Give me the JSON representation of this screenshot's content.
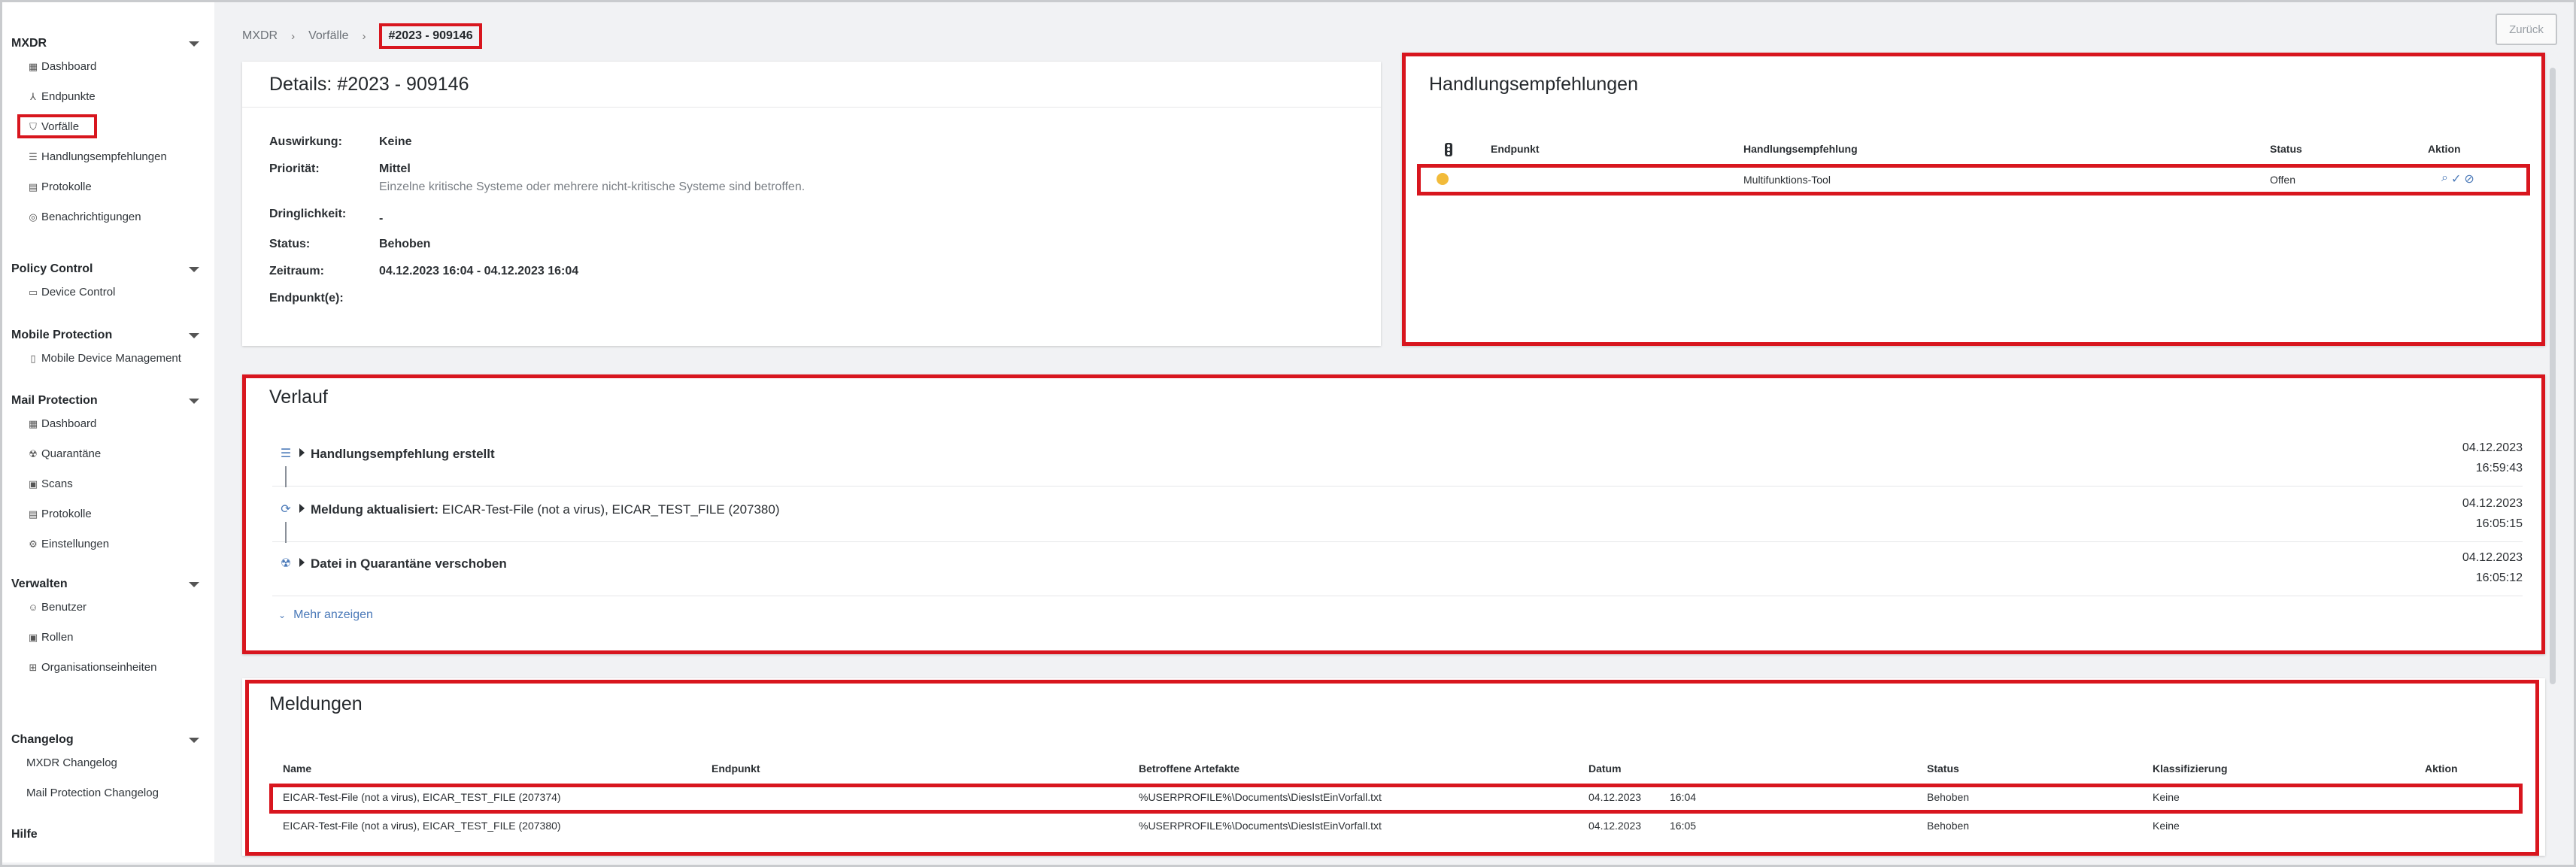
{
  "sidebar": {
    "sections": [
      {
        "title": "MXDR",
        "items": [
          {
            "label": "Dashboard",
            "icon": "dashboard-icon",
            "glyph": "▦"
          },
          {
            "label": "Endpunkte",
            "icon": "endpoints-icon",
            "glyph": "⅄"
          },
          {
            "label": "Vorfälle",
            "icon": "shield-icon",
            "glyph": "⛉"
          },
          {
            "label": "Handlungsempfehlungen",
            "icon": "database-icon",
            "glyph": "☰"
          },
          {
            "label": "Protokolle",
            "icon": "document-icon",
            "glyph": "▤"
          },
          {
            "label": "Benachrichtigungen",
            "icon": "bell-icon",
            "glyph": "◎"
          }
        ]
      },
      {
        "title": "Policy Control",
        "items": [
          {
            "label": "Device Control",
            "icon": "device-icon",
            "glyph": "▭"
          }
        ]
      },
      {
        "title": "Mobile Protection",
        "items": [
          {
            "label": "Mobile Device Management",
            "icon": "mobile-icon",
            "glyph": "▯"
          }
        ]
      },
      {
        "title": "Mail Protection",
        "items": [
          {
            "label": "Dashboard",
            "icon": "dashboard-icon",
            "glyph": "▦"
          },
          {
            "label": "Quarantäne",
            "icon": "biohazard-icon",
            "glyph": "☢"
          },
          {
            "label": "Scans",
            "icon": "scan-icon",
            "glyph": "▣"
          },
          {
            "label": "Protokolle",
            "icon": "document-icon",
            "glyph": "▤"
          },
          {
            "label": "Einstellungen",
            "icon": "gear-icon",
            "glyph": "⚙"
          }
        ]
      },
      {
        "title": "Verwalten",
        "items": [
          {
            "label": "Benutzer",
            "icon": "user-icon",
            "glyph": "☺"
          },
          {
            "label": "Rollen",
            "icon": "roles-icon",
            "glyph": "▣"
          },
          {
            "label": "Organisationseinheiten",
            "icon": "org-icon",
            "glyph": "⊞"
          }
        ]
      },
      {
        "title": "Changelog",
        "items": [
          {
            "label": "MXDR Changelog",
            "icon": "",
            "glyph": ""
          },
          {
            "label": "Mail Protection Changelog",
            "icon": "",
            "glyph": ""
          }
        ]
      },
      {
        "title": "Hilfe",
        "items": []
      }
    ]
  },
  "breadcrumb": {
    "items": [
      "MXDR",
      "Vorfälle"
    ],
    "current": "#2023 - 909146"
  },
  "back_label": "Zurück",
  "details": {
    "title": "Details: #2023 - 909146",
    "rows": [
      {
        "k": "Auswirkung:",
        "v": "Keine"
      },
      {
        "k": "Priorität:",
        "v": "Mittel",
        "sub": "Einzelne kritische Systeme oder mehrere nicht-kritische Systeme sind betroffen."
      },
      {
        "k": "Dringlichkeit:",
        "v": "-"
      },
      {
        "k": "Status:",
        "v": "Behoben"
      },
      {
        "k": "Zeitraum:",
        "v": "04.12.2023 16:04 - 04.12.2023 16:04"
      },
      {
        "k": "Endpunkt(e):",
        "v": ""
      }
    ]
  },
  "recommendations": {
    "title": "Handlungsempfehlungen",
    "headers": {
      "endpoint": "Endpunkt",
      "recommendation": "Handlungsempfehlung",
      "status": "Status",
      "action": "Aktion"
    },
    "rows": [
      {
        "endpoint": "",
        "recommendation": "Multifunktions-Tool",
        "status": "Offen",
        "dot_color": "#f2bb3a"
      }
    ]
  },
  "history": {
    "title": "Verlauf",
    "items": [
      {
        "label": "Handlungsempfehlung erstellt",
        "detail": "",
        "date": "04.12.2023",
        "time": "16:59:43",
        "icon": "database-icon",
        "glyph": "☰"
      },
      {
        "label": "Meldung aktualisiert:",
        "detail": " EICAR-Test-File (not a virus), EICAR_TEST_FILE (207380)",
        "date": "04.12.2023",
        "time": "16:05:15",
        "icon": "refresh-icon",
        "glyph": "⟳"
      },
      {
        "label": "Datei in Quarantäne verschoben",
        "detail": "",
        "date": "04.12.2023",
        "time": "16:05:12",
        "icon": "quarantine-icon",
        "glyph": "☢"
      }
    ],
    "more": "Mehr anzeigen"
  },
  "messages": {
    "title": "Meldungen",
    "headers": {
      "name": "Name",
      "endpoint": "Endpunkt",
      "artifacts": "Betroffene Artefakte",
      "date": "Datum",
      "status": "Status",
      "classification": "Klassifizierung",
      "action": "Aktion"
    },
    "rows": [
      {
        "name": "EICAR-Test-File (not a virus), EICAR_TEST_FILE (207374)",
        "endpoint": "",
        "artifacts": "%USERPROFILE%\\Documents\\DiesIstEinVorfall.txt",
        "date": "04.12.2023",
        "time": "16:04",
        "status": "Behoben",
        "classification": "Keine"
      },
      {
        "name": "EICAR-Test-File (not a virus), EICAR_TEST_FILE (207380)",
        "endpoint": "",
        "artifacts": "%USERPROFILE%\\Documents\\DiesIstEinVorfall.txt",
        "date": "04.12.2023",
        "time": "16:05",
        "status": "Behoben",
        "classification": "Keine"
      }
    ]
  },
  "colors": {
    "highlight": "#d8161e",
    "accent": "#4a79b8",
    "status_dot": "#f2bb3a"
  }
}
